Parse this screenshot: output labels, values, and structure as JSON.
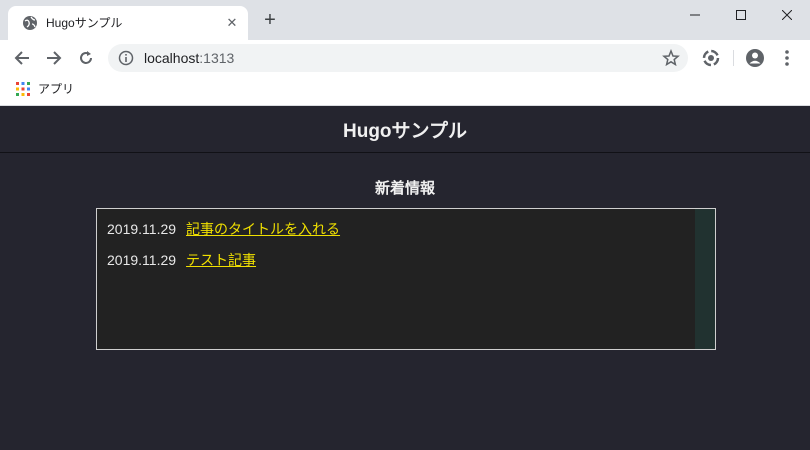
{
  "browser": {
    "tab": {
      "title": "Hugoサンプル"
    },
    "address": {
      "host": "localhost",
      "port": ":1313"
    },
    "bookmarks": {
      "apps_label": "アプリ"
    }
  },
  "site": {
    "title": "Hugoサンプル",
    "news_heading": "新着情報",
    "news": [
      {
        "date": "2019.11.29",
        "title": "記事のタイトルを入れる"
      },
      {
        "date": "2019.11.29",
        "title": "テスト記事"
      }
    ]
  },
  "colors": {
    "page_background": "#25252f",
    "box_background": "#222222",
    "link": "#f0e000",
    "scrollbar": "#213230"
  },
  "icons": [
    "globe-icon",
    "close-icon",
    "plus-icon",
    "back-icon",
    "forward-icon",
    "reload-icon",
    "info-icon",
    "star-icon",
    "extension-icon",
    "profile-icon",
    "menu-icon",
    "apps-icon"
  ]
}
